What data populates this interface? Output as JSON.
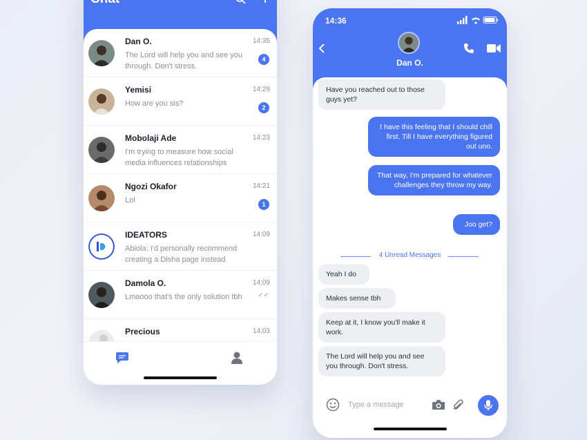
{
  "left_phone": {
    "title": "Chat",
    "header_icons": [
      "search-icon",
      "add-icon"
    ],
    "chats": [
      {
        "name": "Dan O.",
        "preview": "The Lord will help you and see you through. Don't stress.",
        "time": "14:35",
        "unread": "4",
        "avatar_color": "#5a4a3e"
      },
      {
        "name": "Yemisi",
        "preview": "How are you sis?",
        "time": "14:29",
        "unread": "2",
        "avatar_color": "#6b4a35"
      },
      {
        "name": "Mobolaji Ade",
        "preview": "I'm trying to measure how social media influences relationships",
        "time": "14:23",
        "unread": "",
        "avatar_color": "#4b4b4b"
      },
      {
        "name": "Ngozi Okafor",
        "preview": "Lol",
        "time": "14:21",
        "unread": "1",
        "avatar_color": "#8a5a3c"
      },
      {
        "name": "IDEATORS",
        "preview": "Abiola: I'd personally recommend creating a Disha page instead",
        "time": "14:09",
        "unread": "",
        "avatar_color": "#2f4fd6"
      },
      {
        "name": "Damola O.",
        "preview": "Lmaooo that's the only solution tbh",
        "time": "14:09",
        "unread": "",
        "read": "✓✓",
        "avatar_color": "#3a3a3a"
      },
      {
        "name": "Precious",
        "preview": "",
        "time": "14:03",
        "unread": "",
        "avatar_color": "#d9d9d9"
      }
    ],
    "footer": {
      "chat_tab_icon": "chat-bubble-icon",
      "profile_tab_icon": "user-icon"
    }
  },
  "right_phone": {
    "status_time": "14:36",
    "contact_name": "Dan O.",
    "messages": [
      {
        "dir": "in",
        "text": "Have you reached out to those guys yet?"
      },
      {
        "dir": "out",
        "text": "I have this feeling that I should chill first. Till I have everything figured out uno."
      },
      {
        "dir": "out",
        "text": "That way, I'm prepared for whatever challenges they throw my way."
      },
      {
        "dir": "out",
        "text": "Joo get?"
      },
      {
        "dir": "in",
        "text": "Yeah I do"
      },
      {
        "dir": "in",
        "text": "Makes sense tbh"
      },
      {
        "dir": "in",
        "text": "Keep at it, I know you'll make it work."
      },
      {
        "dir": "in",
        "text": "The Lord will help you and see you through. Don't stress."
      }
    ],
    "unread_divider": "4 Unread Messages",
    "composer": {
      "placeholder": "Type a message"
    }
  },
  "colors": {
    "accent": "#4a74f0",
    "bubble_in": "#eeeff3",
    "muted_text": "#8a8f99"
  }
}
